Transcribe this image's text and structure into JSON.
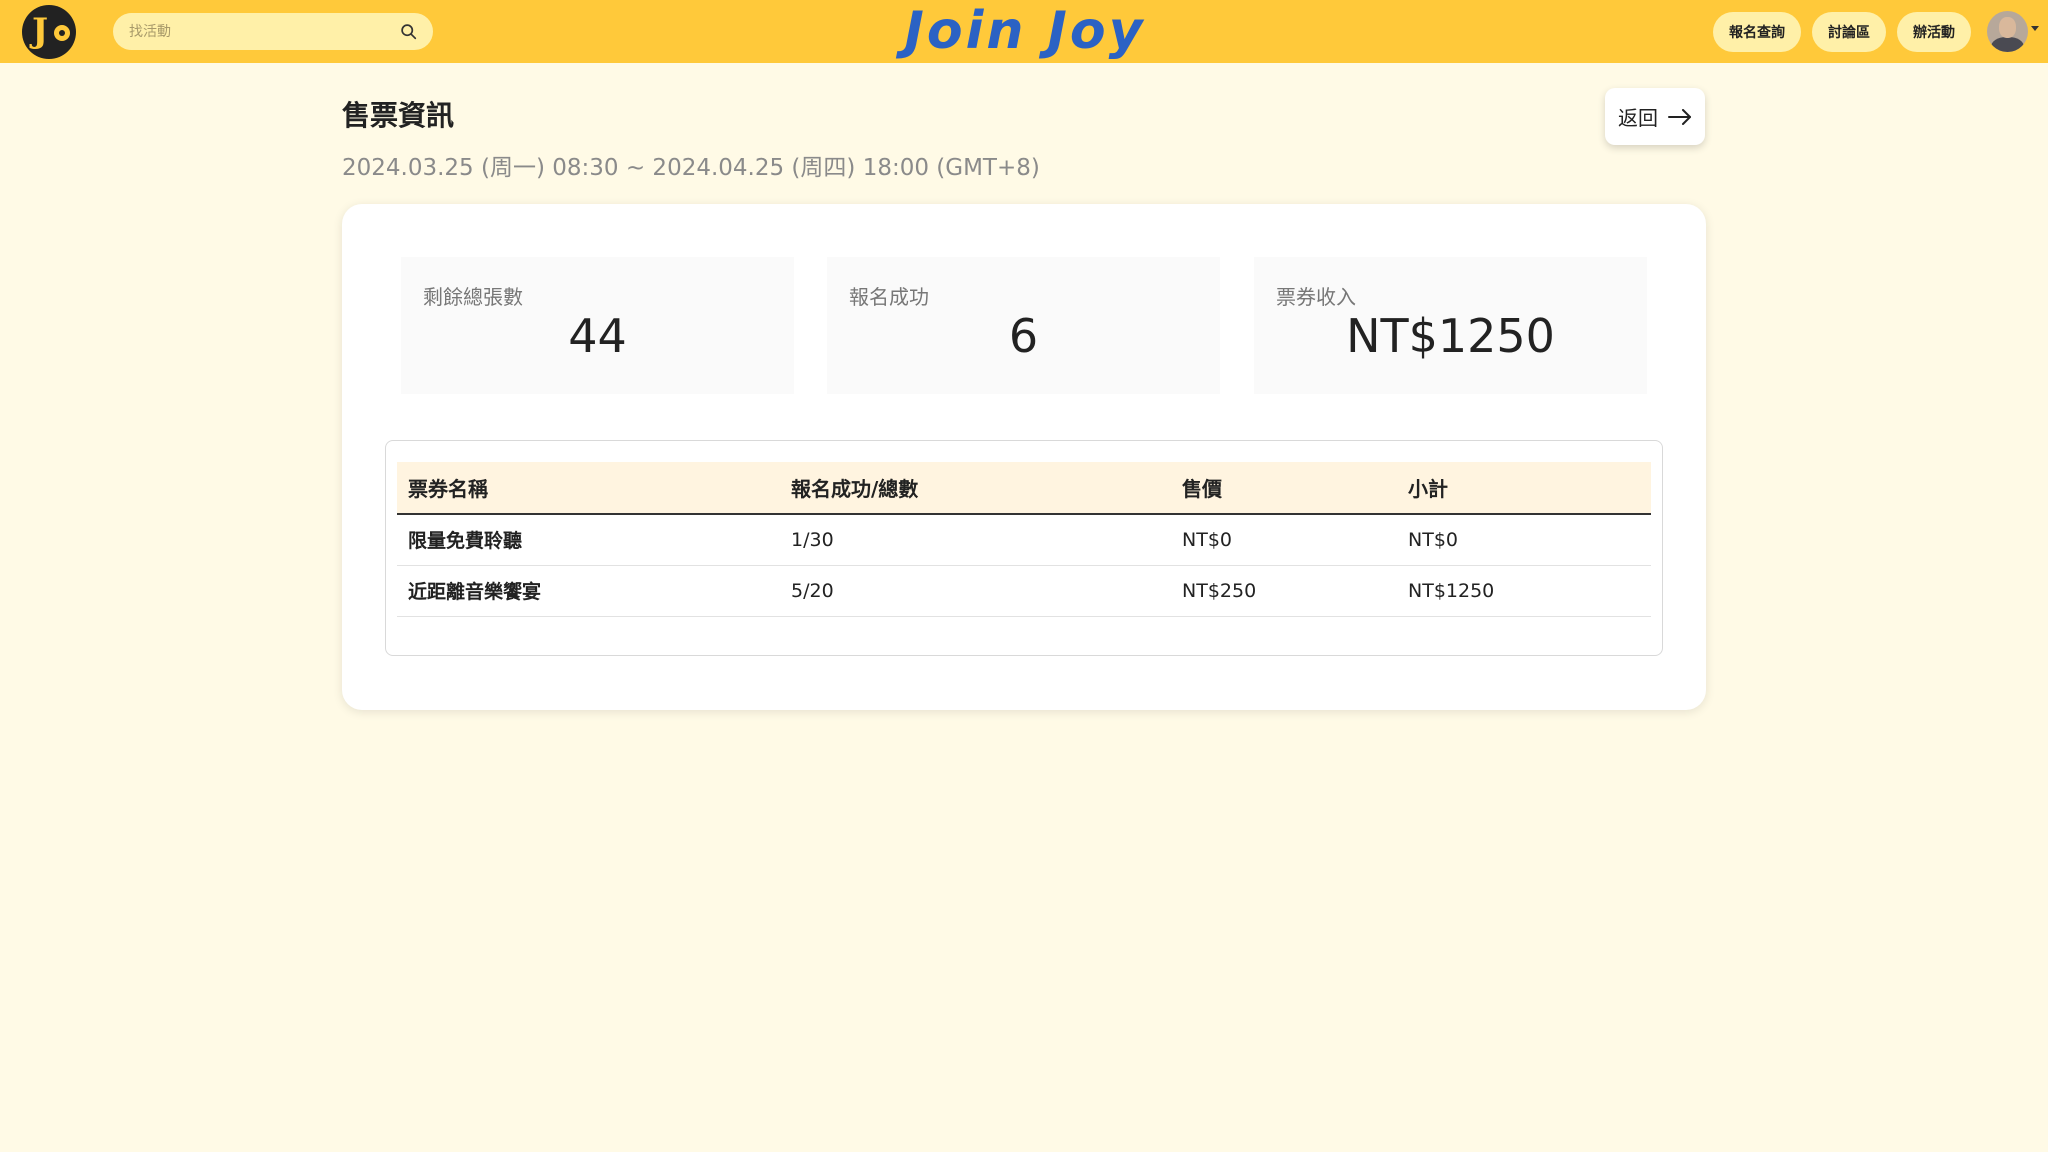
{
  "header": {
    "brand": "Join Joy",
    "search_placeholder": "找活動",
    "nav": [
      {
        "label": "報名查詢"
      },
      {
        "label": "討論區"
      },
      {
        "label": "辦活動"
      }
    ],
    "colors": {
      "bar": "#ffc93a",
      "brand": "#2b62c4",
      "pill": "#fff0a8"
    }
  },
  "page": {
    "title": "售票資訊",
    "date_range": "2024.03.25 (周一) 08:30 ~ 2024.04.25 (周四) 18:00 (GMT+8)",
    "back_label": "返回"
  },
  "stats": [
    {
      "label": "剩餘總張數",
      "value": "44"
    },
    {
      "label": "報名成功",
      "value": "6"
    },
    {
      "label": "票券收入",
      "value": "NT$1250"
    }
  ],
  "table": {
    "columns": [
      "票券名稱",
      "報名成功/總數",
      "售價",
      "小計"
    ],
    "rows": [
      [
        "限量免費聆聽",
        "1/30",
        "NT$0",
        "NT$0"
      ],
      [
        "近距離音樂饗宴",
        "5/20",
        "NT$250",
        "NT$1250"
      ]
    ]
  }
}
